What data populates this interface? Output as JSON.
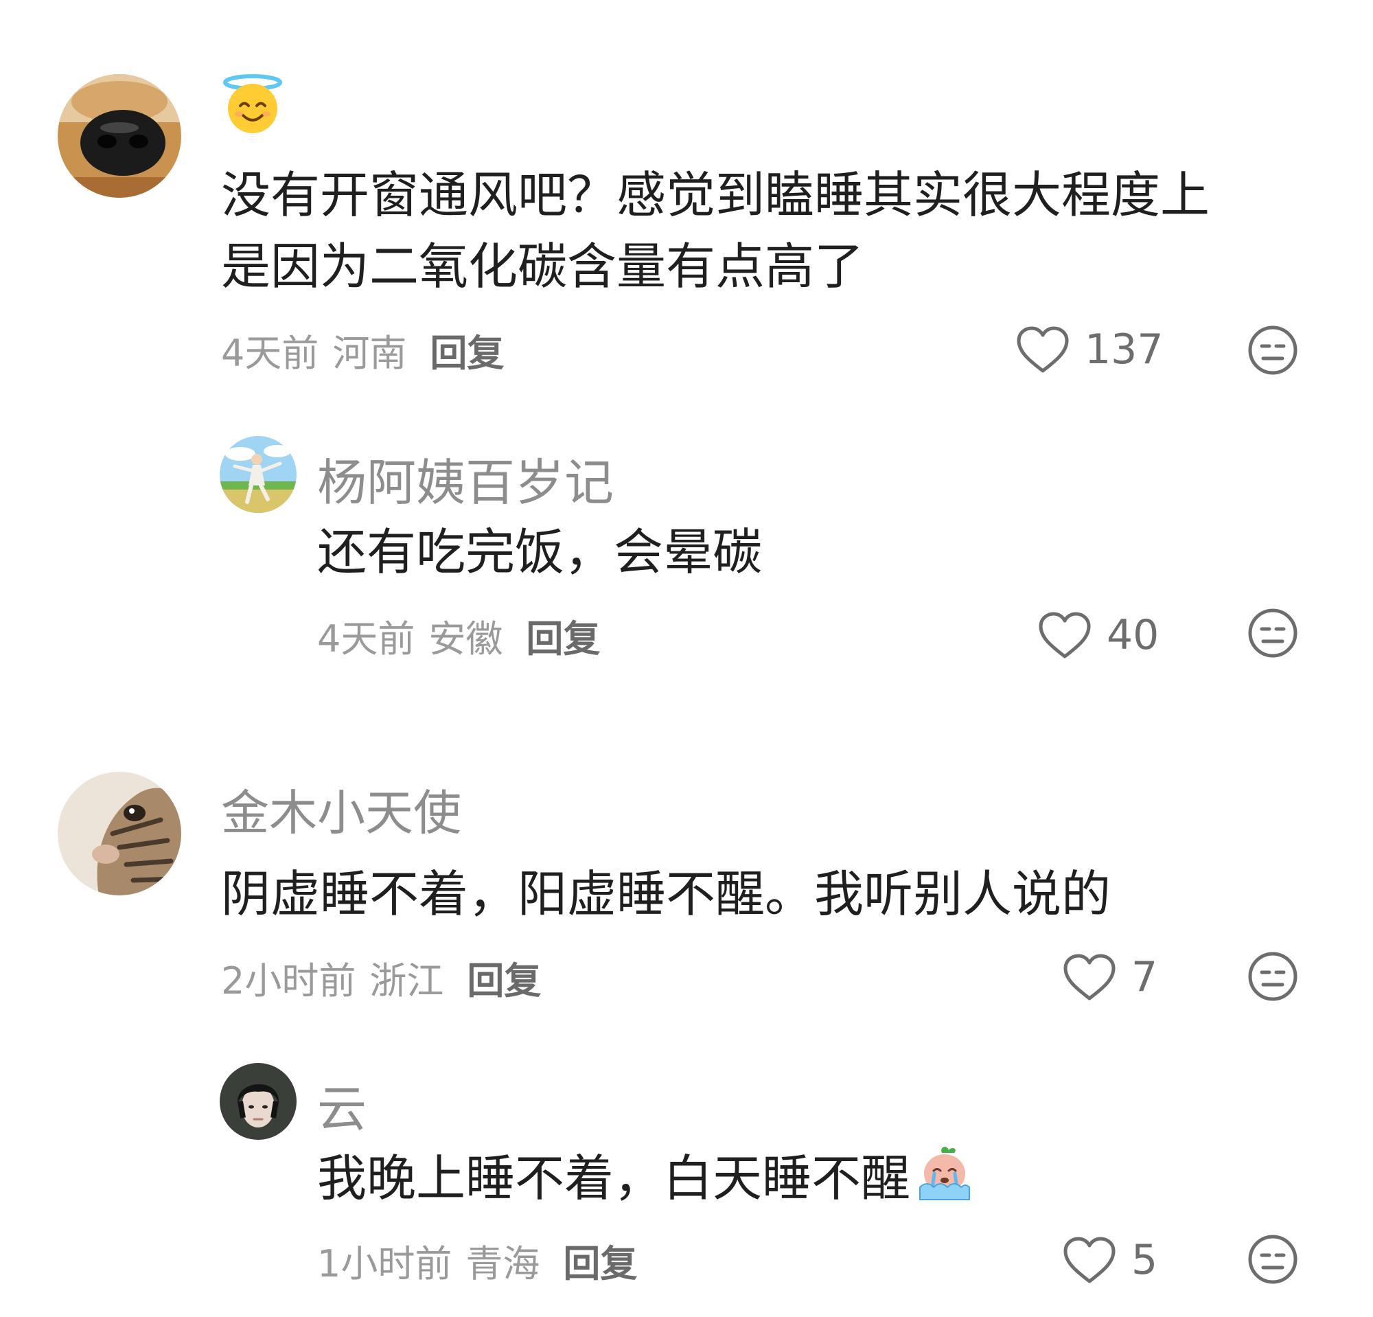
{
  "comments": [
    {
      "username": "",
      "name_emoji": "smiling-face-with-halo",
      "text_lines": [
        "没有开窗通风吧？感觉到瞌睡其实很大程度上",
        "是因为二氧化碳含量有点高了"
      ],
      "time": "4天前",
      "location": "河南",
      "reply_label": "回复",
      "likes": "137",
      "avatar": "dog-nose-closeup"
    },
    {
      "username": "杨阿姨百岁记",
      "text_lines": [
        "还有吃完饭，会晕碳"
      ],
      "time": "4天前",
      "location": "安徽",
      "reply_label": "回复",
      "likes": "40",
      "avatar": "tai-chi-landscape"
    },
    {
      "username": "金木小天使",
      "text_lines": [
        "阴虚睡不着，阳虚睡不醒。我听别人说的"
      ],
      "time": "2小时前",
      "location": "浙江",
      "reply_label": "回复",
      "likes": "7",
      "avatar": "tabby-cat-closeup"
    },
    {
      "username": "云",
      "text_lines": [
        "我晚上睡不着，白天睡不醒"
      ],
      "trailing_sticker": "crying-peach-sticker",
      "time": "1小时前",
      "location": "青海",
      "reply_label": "回复",
      "likes": "5",
      "avatar": "dark-hair-portrait"
    }
  ],
  "colors": {
    "text": "#1f1f1f",
    "username": "#8d8d8d",
    "meta": "#9a9a9a",
    "reply": "#6a6a6a",
    "icon": "#6d6d6d"
  }
}
